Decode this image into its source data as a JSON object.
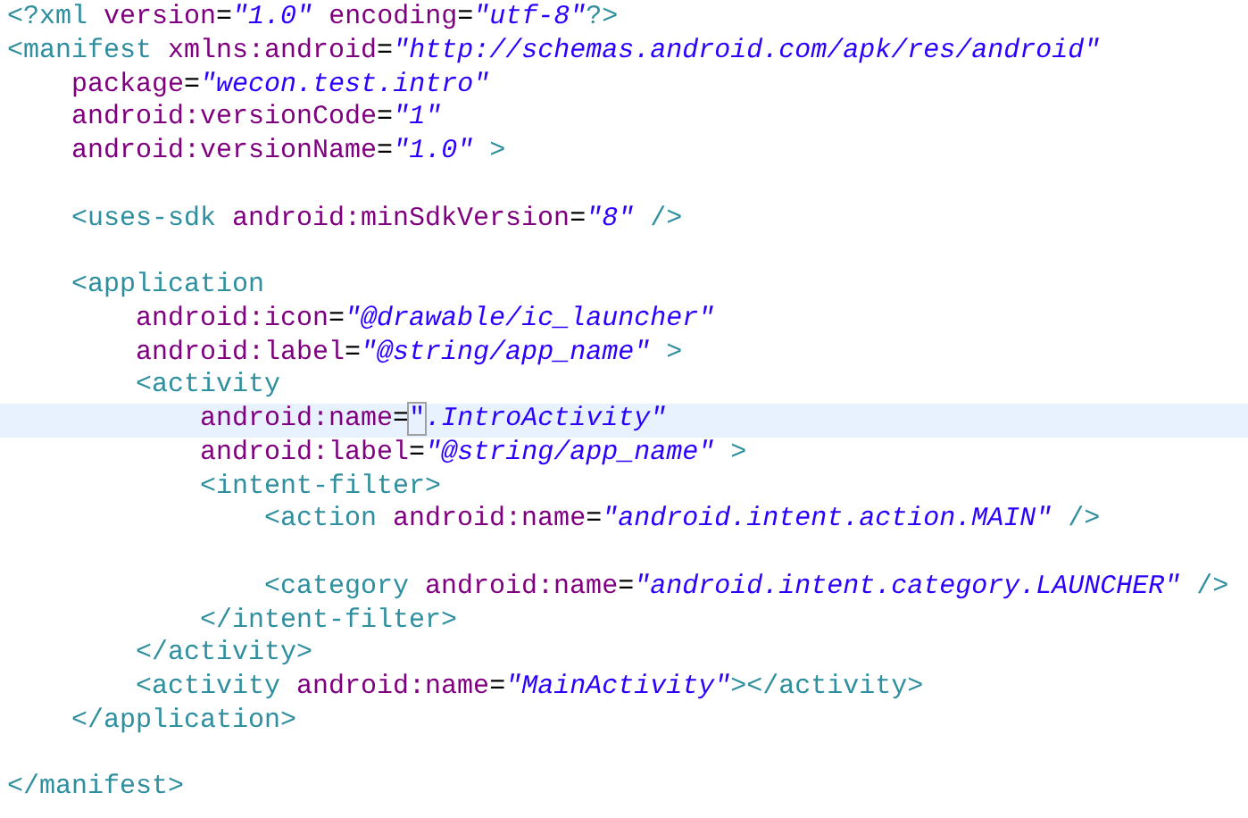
{
  "editor": {
    "lines": [
      {
        "kind": "code",
        "current": false,
        "tokens": [
          {
            "kind": "tag",
            "text": "<?xml "
          },
          {
            "kind": "attr",
            "text": "version"
          },
          {
            "kind": "eq",
            "text": "="
          },
          {
            "kind": "value",
            "text": "\"1.0\""
          },
          {
            "kind": "attr",
            "text": " encoding"
          },
          {
            "kind": "eq",
            "text": "="
          },
          {
            "kind": "value",
            "text": "\"utf-8\""
          },
          {
            "kind": "tag",
            "text": "?>"
          }
        ]
      },
      {
        "kind": "code",
        "current": false,
        "tokens": [
          {
            "kind": "tag",
            "text": "<manifest "
          },
          {
            "kind": "attr",
            "text": "xmlns:android"
          },
          {
            "kind": "eq",
            "text": "="
          },
          {
            "kind": "value",
            "text": "\"http://schemas.android.com/apk/res/android\""
          }
        ]
      },
      {
        "kind": "code",
        "current": false,
        "tokens": [
          {
            "kind": "attr",
            "text": "    package"
          },
          {
            "kind": "eq",
            "text": "="
          },
          {
            "kind": "value",
            "text": "\"wecon.test.intro\""
          }
        ]
      },
      {
        "kind": "code",
        "current": false,
        "tokens": [
          {
            "kind": "attr",
            "text": "    android:versionCode"
          },
          {
            "kind": "eq",
            "text": "="
          },
          {
            "kind": "value",
            "text": "\"1\""
          }
        ]
      },
      {
        "kind": "code",
        "current": false,
        "tokens": [
          {
            "kind": "attr",
            "text": "    android:versionName"
          },
          {
            "kind": "eq",
            "text": "="
          },
          {
            "kind": "value",
            "text": "\"1.0\""
          },
          {
            "kind": "tag",
            "text": " >"
          }
        ]
      },
      {
        "kind": "blank"
      },
      {
        "kind": "code",
        "current": false,
        "tokens": [
          {
            "kind": "tag",
            "text": "    <uses-sdk "
          },
          {
            "kind": "attr",
            "text": "android:minSdkVersion"
          },
          {
            "kind": "eq",
            "text": "="
          },
          {
            "kind": "value",
            "text": "\"8\""
          },
          {
            "kind": "tag",
            "text": " />"
          }
        ]
      },
      {
        "kind": "blank"
      },
      {
        "kind": "code",
        "current": false,
        "tokens": [
          {
            "kind": "tag",
            "text": "    <application"
          }
        ]
      },
      {
        "kind": "code",
        "current": false,
        "tokens": [
          {
            "kind": "attr",
            "text": "        android:icon"
          },
          {
            "kind": "eq",
            "text": "="
          },
          {
            "kind": "value",
            "text": "\"@drawable/ic_launcher\""
          }
        ]
      },
      {
        "kind": "code",
        "current": false,
        "tokens": [
          {
            "kind": "attr",
            "text": "        android:label"
          },
          {
            "kind": "eq",
            "text": "="
          },
          {
            "kind": "value",
            "text": "\"@string/app_name\""
          },
          {
            "kind": "tag",
            "text": " >"
          }
        ]
      },
      {
        "kind": "code",
        "current": false,
        "tokens": [
          {
            "kind": "tag",
            "text": "        <activity"
          }
        ]
      },
      {
        "kind": "code",
        "current": true,
        "tokens": [
          {
            "kind": "attr",
            "text": "            android:name"
          },
          {
            "kind": "eq",
            "text": "="
          },
          {
            "kind": "value",
            "text": "\"",
            "matched": true
          },
          {
            "kind": "value",
            "text": ".IntroActivity\""
          }
        ]
      },
      {
        "kind": "code",
        "current": false,
        "tokens": [
          {
            "kind": "attr",
            "text": "            android:label"
          },
          {
            "kind": "eq",
            "text": "="
          },
          {
            "kind": "value",
            "text": "\"@string/app_name\""
          },
          {
            "kind": "tag",
            "text": " >"
          }
        ]
      },
      {
        "kind": "code",
        "current": false,
        "tokens": [
          {
            "kind": "tag",
            "text": "            <intent-filter>"
          }
        ]
      },
      {
        "kind": "code",
        "current": false,
        "tokens": [
          {
            "kind": "tag",
            "text": "                <action "
          },
          {
            "kind": "attr",
            "text": "android:name"
          },
          {
            "kind": "eq",
            "text": "="
          },
          {
            "kind": "value",
            "text": "\"android.intent.action.MAIN\""
          },
          {
            "kind": "tag",
            "text": " />"
          }
        ]
      },
      {
        "kind": "blank"
      },
      {
        "kind": "code",
        "current": false,
        "tokens": [
          {
            "kind": "tag",
            "text": "                <category "
          },
          {
            "kind": "attr",
            "text": "android:name"
          },
          {
            "kind": "eq",
            "text": "="
          },
          {
            "kind": "value",
            "text": "\"android.intent.category.LAUNCHER\""
          },
          {
            "kind": "tag",
            "text": " />"
          }
        ]
      },
      {
        "kind": "code",
        "current": false,
        "tokens": [
          {
            "kind": "tag",
            "text": "            </intent-filter>"
          }
        ]
      },
      {
        "kind": "code",
        "current": false,
        "tokens": [
          {
            "kind": "tag",
            "text": "        </activity>"
          }
        ]
      },
      {
        "kind": "code",
        "current": false,
        "tokens": [
          {
            "kind": "tag",
            "text": "        <activity "
          },
          {
            "kind": "attr",
            "text": "android:name"
          },
          {
            "kind": "eq",
            "text": "="
          },
          {
            "kind": "value",
            "text": "\"MainActivity\""
          },
          {
            "kind": "tag",
            "text": "></activity>"
          }
        ]
      },
      {
        "kind": "code",
        "current": false,
        "tokens": [
          {
            "kind": "tag",
            "text": "    </application>"
          }
        ]
      },
      {
        "kind": "blank"
      },
      {
        "kind": "code",
        "current": false,
        "tokens": [
          {
            "kind": "tag",
            "text": "</manifest>"
          }
        ]
      }
    ]
  }
}
